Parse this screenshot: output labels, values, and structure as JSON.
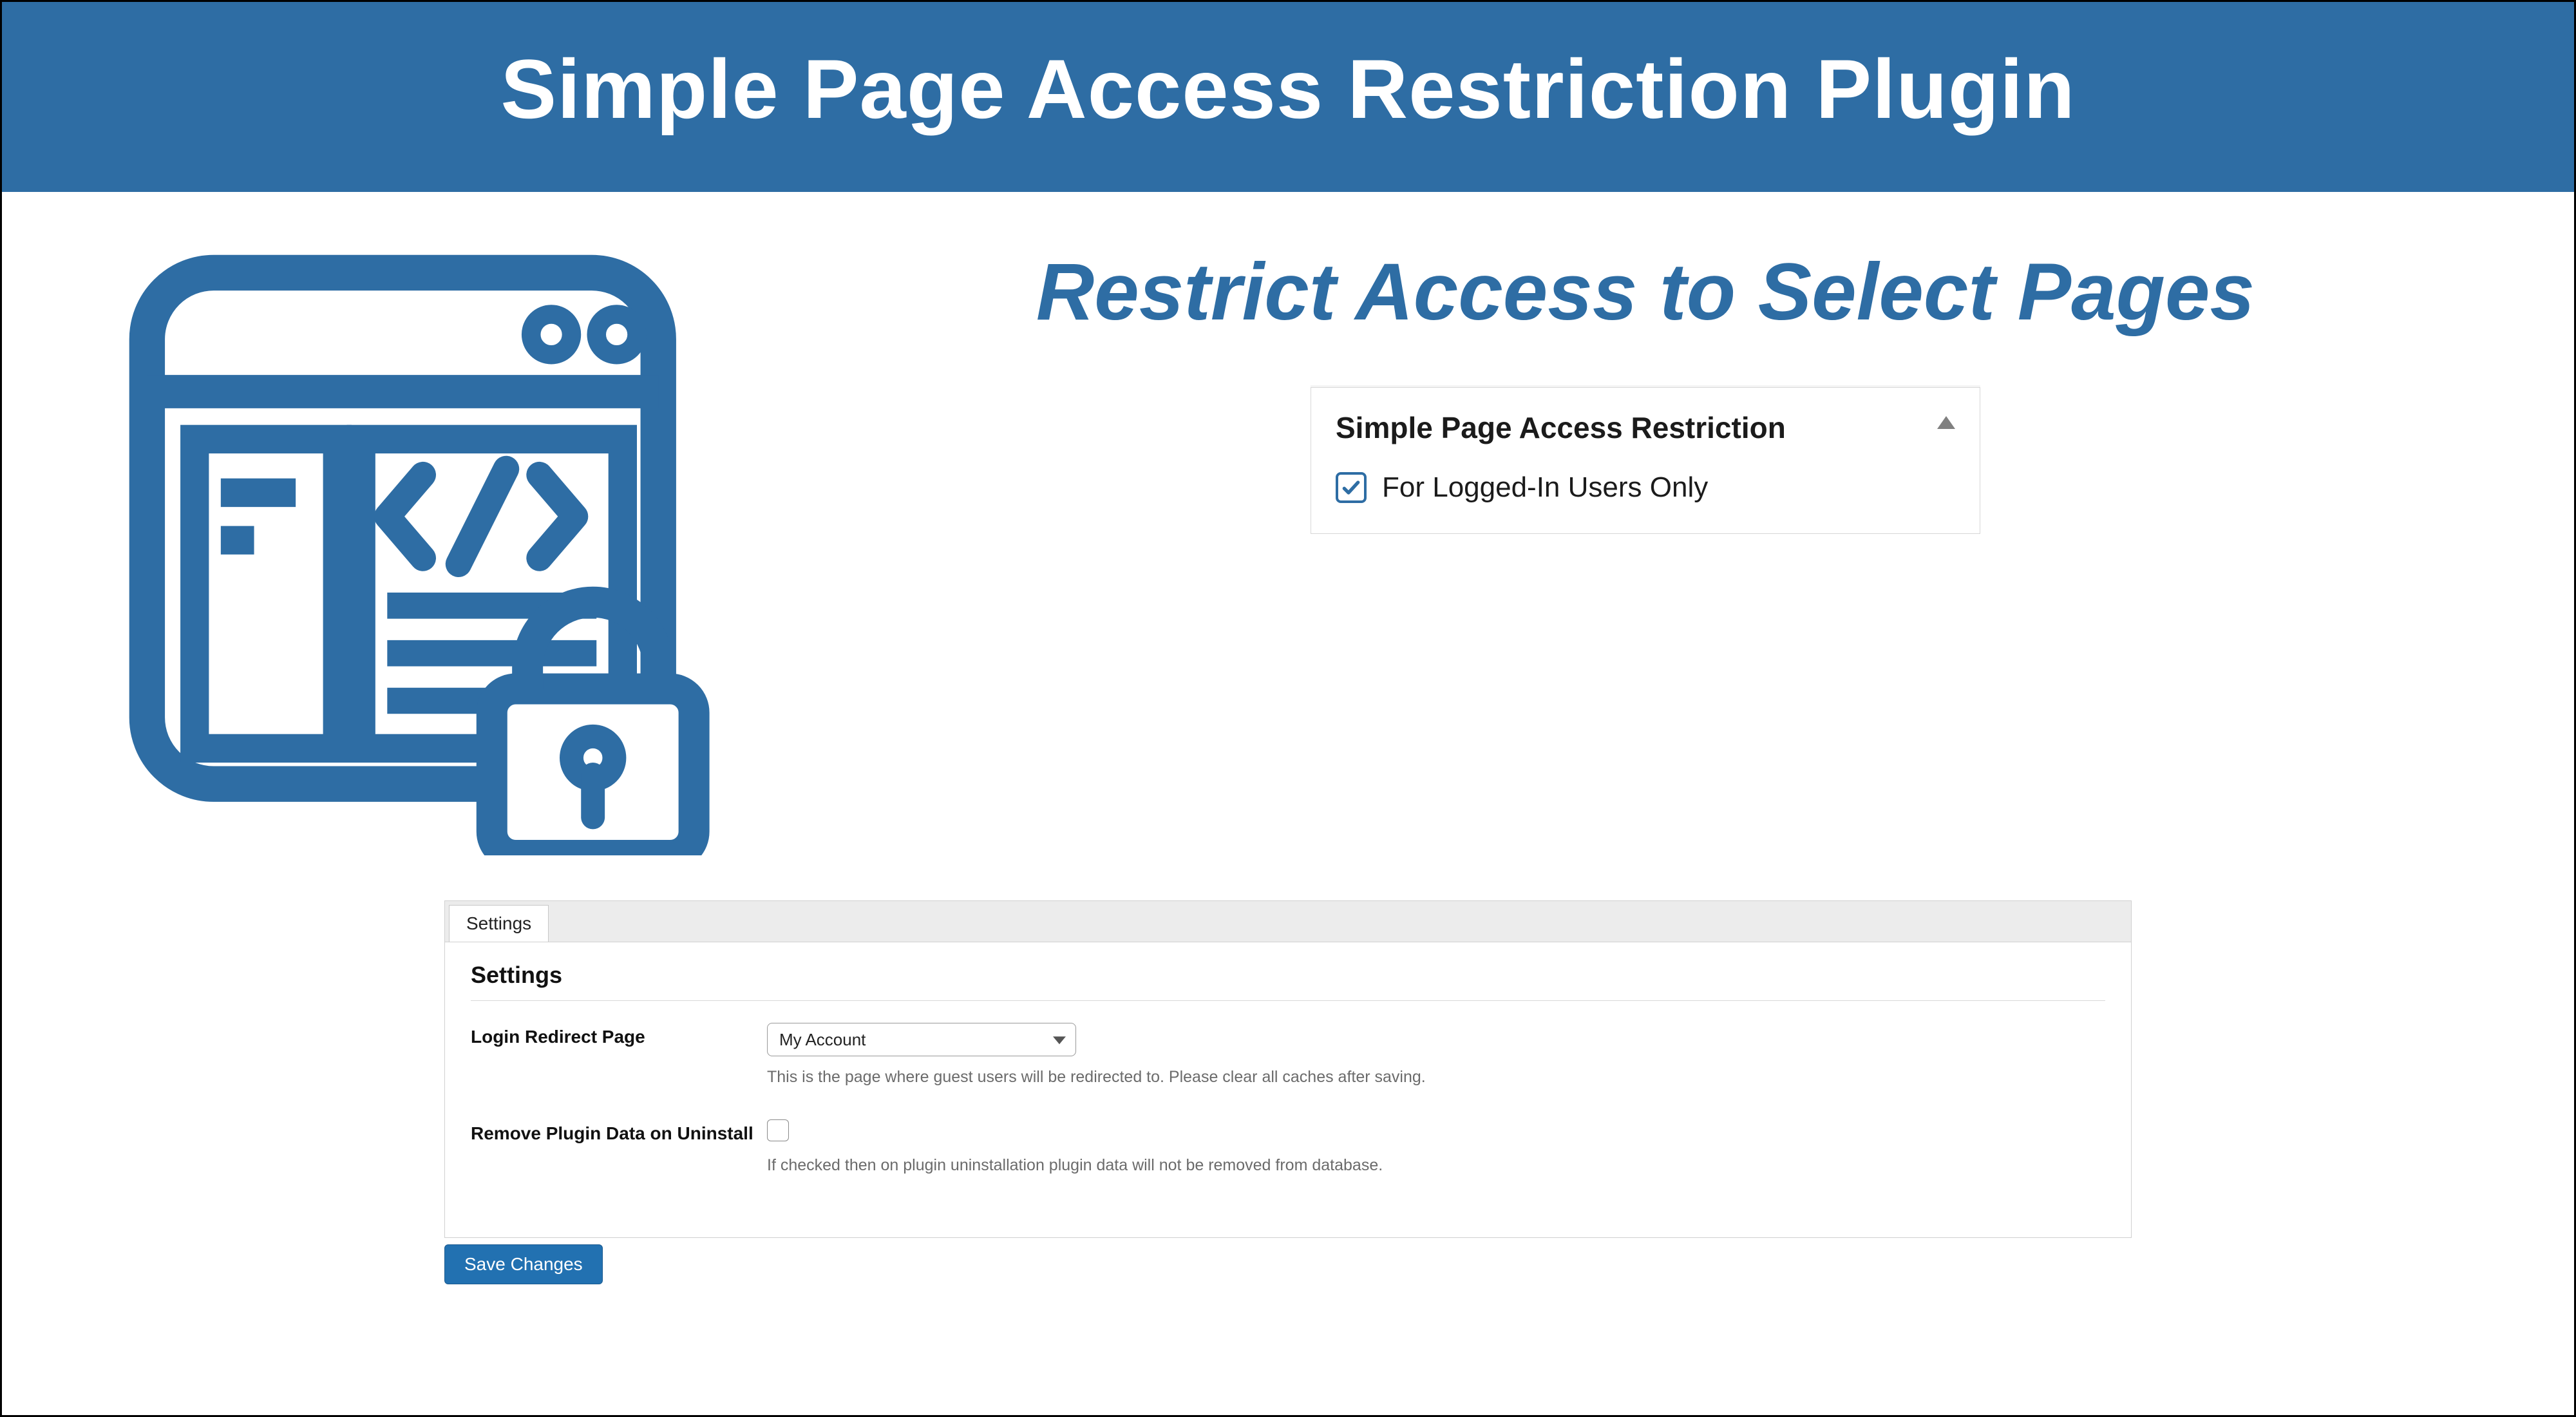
{
  "header": {
    "title": "Simple Page Access Restriction Plugin"
  },
  "tagline": "Restrict Access to Select Pages",
  "metabox": {
    "title": "Simple Page Access Restriction",
    "optionLabel": "For Logged-In Users Only",
    "optionChecked": true
  },
  "settings": {
    "tabLabel": "Settings",
    "heading": "Settings",
    "loginRedirect": {
      "label": "Login Redirect Page",
      "value": "My Account",
      "help": "This is the page where guest users will be redirected to. Please clear all caches after saving."
    },
    "removeData": {
      "label": "Remove Plugin Data on Uninstall",
      "checked": false,
      "help": "If checked then on plugin uninstallation plugin data will not be removed from database."
    },
    "saveLabel": "Save Changes"
  },
  "colors": {
    "brand": "#2e6da4",
    "wpPrimary": "#2271b1"
  }
}
